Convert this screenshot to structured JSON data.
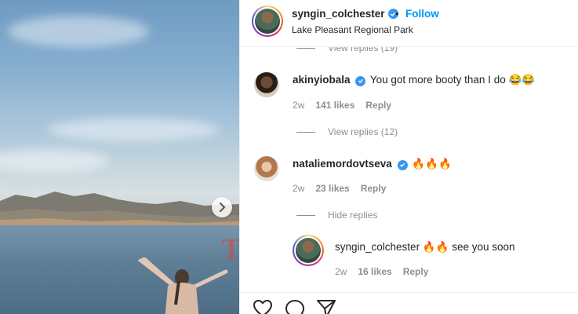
{
  "post": {
    "username": "syngin_colchester",
    "separator": "•",
    "follow_label": "Follow",
    "location": "Lake Pleasant Regional Park"
  },
  "comments": {
    "top_view_replies": "View replies (19)",
    "items": [
      {
        "username": "akinyiobala",
        "verified": true,
        "text": "You got more booty than I do 😂😂",
        "time": "2w",
        "likes": "141 likes",
        "reply_label": "Reply",
        "view_replies": "View replies (12)"
      },
      {
        "username": "nataliemordovtseva",
        "verified": true,
        "text": "🔥🔥🔥",
        "time": "2w",
        "likes": "23 likes",
        "reply_label": "Reply",
        "hide_replies": "Hide replies",
        "replies": [
          {
            "username": "syngin_colchester",
            "text": "🔥🔥 see you soon",
            "time": "2w",
            "likes": "16 likes",
            "reply_label": "Reply"
          }
        ]
      }
    ]
  },
  "watermark": "TV",
  "icons": {
    "like": "heart-icon",
    "comment": "comment-icon",
    "share": "share-icon",
    "next": "chevron-right-icon"
  },
  "colors": {
    "accent": "#0095f6",
    "verified": "#3897f0",
    "muted": "#8e8e8e"
  }
}
